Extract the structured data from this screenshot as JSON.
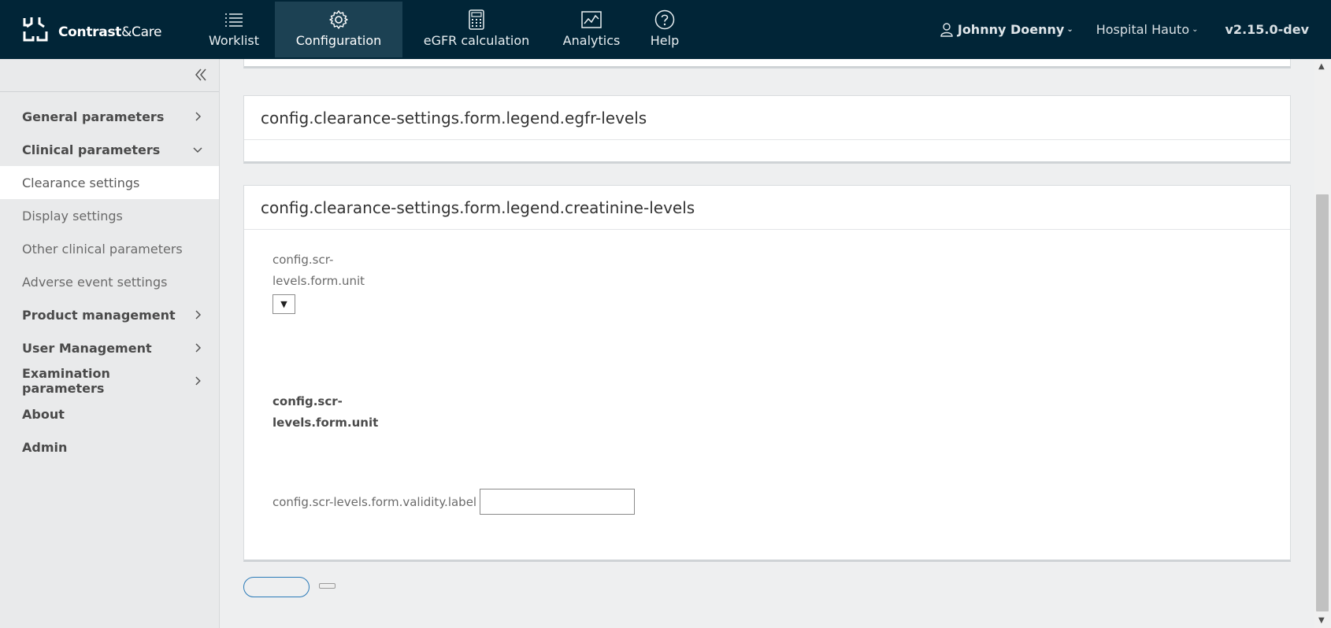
{
  "brand": {
    "name_bold": "Contrast",
    "name_light": "&Care"
  },
  "nav": [
    {
      "label": "Worklist",
      "icon": "list-icon",
      "active": false
    },
    {
      "label": "Configuration",
      "icon": "gear-icon",
      "active": true
    },
    {
      "label": "eGFR calculation",
      "icon": "calculator-icon",
      "active": false
    },
    {
      "label": "Analytics",
      "icon": "chart-icon",
      "active": false
    },
    {
      "label": "Help",
      "icon": "help-icon",
      "active": false
    }
  ],
  "header": {
    "user": "Johnny Doenny",
    "hospital": "Hospital Hauto",
    "version": "v2.15.0-dev"
  },
  "sidebar": {
    "items": [
      {
        "label": "General parameters",
        "type": "group",
        "chevron": "right"
      },
      {
        "label": "Clinical parameters",
        "type": "group",
        "chevron": "down"
      },
      {
        "label": "Clearance settings",
        "type": "sub",
        "active": true
      },
      {
        "label": "Display settings",
        "type": "sub"
      },
      {
        "label": "Other clinical parameters",
        "type": "sub"
      },
      {
        "label": "Adverse event settings",
        "type": "sub"
      },
      {
        "label": "Product management",
        "type": "group",
        "chevron": "right"
      },
      {
        "label": "User Management",
        "type": "group",
        "chevron": "right"
      },
      {
        "label": "Examination parameters",
        "type": "group",
        "chevron": "right"
      },
      {
        "label": "About",
        "type": "group"
      },
      {
        "label": "Admin",
        "type": "group"
      }
    ]
  },
  "main": {
    "egfr_legend": "config.clearance-settings.form.legend.egfr-levels",
    "creatinine_legend": "config.clearance-settings.form.legend.creatinine-levels",
    "unit_label_line1": "config.scr-",
    "unit_label_line2": "levels.form.unit",
    "unit_select_value": "▼",
    "unit_bold_line1": "config.scr-",
    "unit_bold_line2": "levels.form.unit",
    "validity_label": "config.scr-levels.form.validity.label",
    "validity_value": ""
  }
}
